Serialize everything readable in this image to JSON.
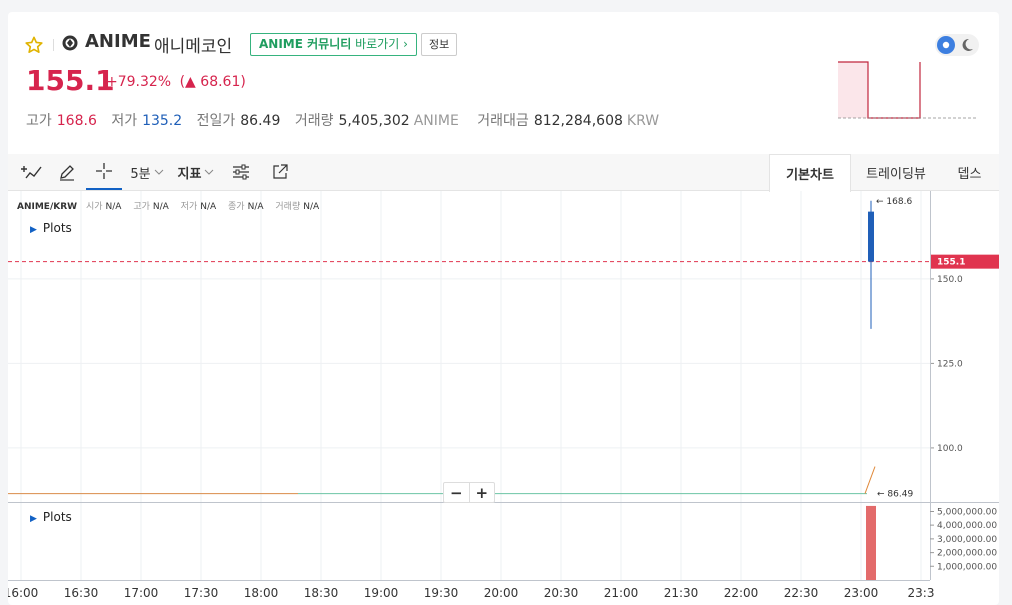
{
  "header": {
    "coin_symbol": "ANIME",
    "coin_name_kr": "애니메코인",
    "community_bold": "ANIME 커뮤니티",
    "community_rest": " 바로가기 ›",
    "info_label": "정보",
    "price": "155.1",
    "change_pct": "+79.32%",
    "change_arrow": "▲",
    "change_abs": "68.61",
    "stats": {
      "high_label": "고가",
      "high_value": "168.6",
      "low_label": "저가",
      "low_value": "135.2",
      "prev_label": "전일가",
      "prev_value": "86.49",
      "volume_label": "거래량",
      "volume_value": "5,405,302",
      "volume_unit": "ANIME",
      "amount_label": "거래대금",
      "amount_value": "812,284,608",
      "amount_unit": "KRW"
    },
    "colors": {
      "up": "#d6244d",
      "down": "#1f5fb8",
      "accent": "#1261c4",
      "community": "#1f9d5f"
    }
  },
  "toolbar": {
    "icons": [
      "line-tools-icon",
      "pencil-icon",
      "crosshair-icon"
    ],
    "interval_label": "5분",
    "indicator_label": "지표",
    "settings_icon": "sliders-icon",
    "popout_icon": "external-link-icon",
    "tabs": [
      "기본차트",
      "트레이딩뷰",
      "뎁스"
    ],
    "selected_tab": "기본차트"
  },
  "chart": {
    "ohlc": {
      "pair": "ANIME/KRW",
      "items": [
        {
          "label": "시가",
          "value": "N/A"
        },
        {
          "label": "고가",
          "value": "N/A"
        },
        {
          "label": "저가",
          "value": "N/A"
        },
        {
          "label": "종가",
          "value": "N/A"
        },
        {
          "label": "거래량",
          "value": "N/A"
        }
      ]
    },
    "plots_label": "Plots",
    "zoom_minus": "−",
    "zoom_plus": "+",
    "price_tag": "155.1",
    "high_marker": "← 168.6",
    "prev_marker": "← 86.49",
    "y_ticks": [
      "150.0",
      "125.0",
      "100.0"
    ],
    "vol_ticks": [
      "5,000,000.00",
      "4,000,000.00",
      "3,000,000.00",
      "2,000,000.00",
      "1,000,000.00"
    ],
    "x_ticks": [
      "16:00",
      "16:30",
      "17:00",
      "17:30",
      "18:00",
      "18:30",
      "19:00",
      "19:30",
      "20:00",
      "20:30",
      "21:00",
      "21:30",
      "22:00",
      "22:30",
      "23:00",
      "23:3"
    ]
  },
  "chart_data": {
    "type": "line",
    "title": "",
    "xlabel": "",
    "ylabel": "",
    "ylim": [
      84,
      176
    ],
    "candle": {
      "x": "23:05",
      "open": 169.9,
      "high": 168.6,
      "low": 135.2,
      "close": 155.1,
      "color": "#1f5fb8"
    },
    "prev_close_line": {
      "value": 86.49,
      "from": "16:00",
      "to": "23:05"
    },
    "current_price": 155.1,
    "volume": {
      "x": "23:05",
      "value": 5405302,
      "ylim": [
        0,
        5400000
      ]
    }
  }
}
